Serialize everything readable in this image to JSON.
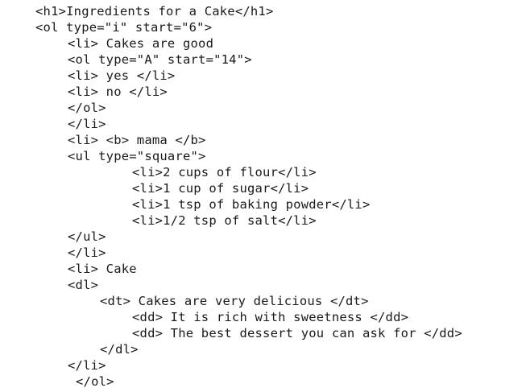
{
  "code_lines": [
    "<h1>Ingredients for a Cake</h1>",
    "<ol type=\"i\" start=\"6\">",
    "<li> Cakes are good",
    "<ol type=\"A\" start=\"14\">",
    "<li> yes </li>",
    "<li> no </li>",
    "</ol>",
    "</li>",
    "<li> <b> mama </b>",
    "<ul type=\"square\">",
    "<li>2 cups of flour</li>",
    "<li>1 cup of sugar</li>",
    "<li>1 tsp of baking powder</li>",
    "<li>1/2 tsp of salt</li>",
    "</ul>",
    "</li>",
    "<li> Cake",
    "<dl>",
    "<dt> Cakes are very delicious </dt>",
    "<dd> It is rich with sweetness </dd>",
    "<dd> The best dessert you can ask for </dd>",
    "</dl>",
    "</li>",
    "</ol>"
  ]
}
